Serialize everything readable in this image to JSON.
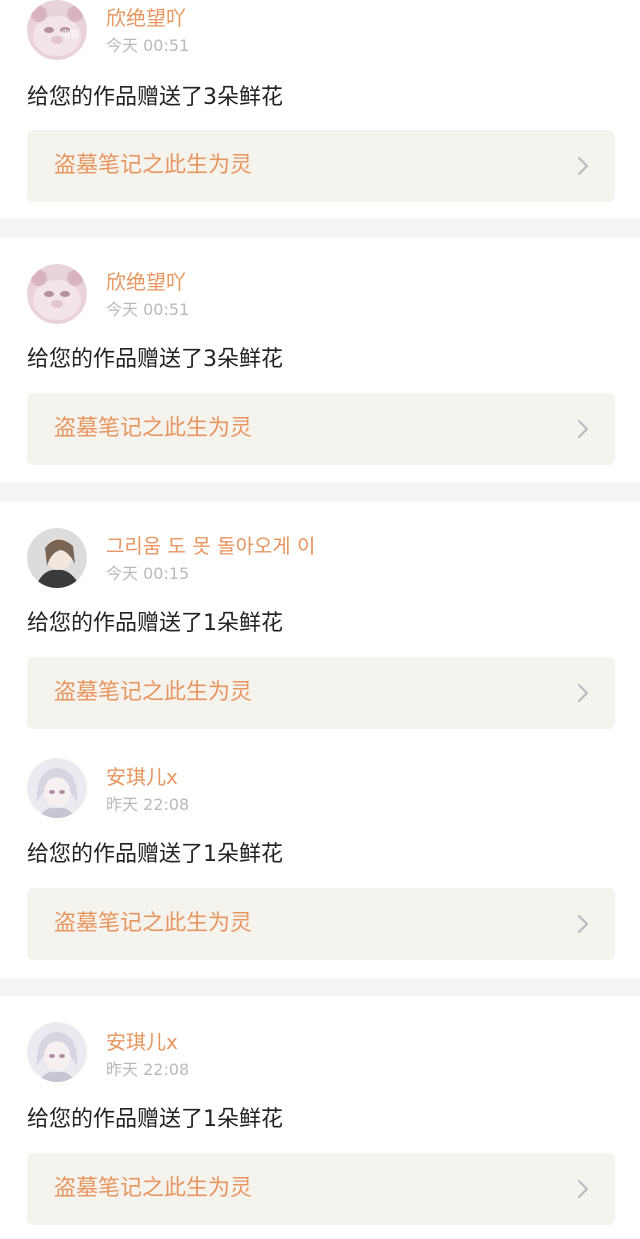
{
  "colors": {
    "accent": "#e8955e",
    "timestamp": "#b9b9b9",
    "message": "#222222",
    "link_background": "#f5f3ee",
    "divider": "#f5f5f5"
  },
  "notifications": [
    {
      "user_name": "欣绝望吖",
      "time": "今天 00:51",
      "message": "给您的作品赠送了3朵鲜花",
      "work_title": "盗墓笔记之此生为灵",
      "avatar_badge": "电智",
      "chevron_icon": "chevron-right-icon"
    },
    {
      "user_name": "欣绝望吖",
      "time": "今天 00:51",
      "message": "给您的作品赠送了3朵鲜花",
      "work_title": "盗墓笔记之此生为灵",
      "chevron_icon": "chevron-right-icon"
    },
    {
      "user_name": "그리움 도 못 돌아오게 이",
      "time": "今天 00:15",
      "message": "给您的作品赠送了1朵鲜花",
      "work_title": "盗墓笔记之此生为灵",
      "chevron_icon": "chevron-right-icon"
    },
    {
      "user_name": "安琪儿x",
      "time": "昨天 22:08",
      "message": "给您的作品赠送了1朵鲜花",
      "work_title": "盗墓笔记之此生为灵",
      "chevron_icon": "chevron-right-icon"
    },
    {
      "user_name": "安琪儿x",
      "time": "昨天 22:08",
      "message": "给您的作品赠送了1朵鲜花",
      "work_title": "盗墓笔记之此生为灵",
      "chevron_icon": "chevron-right-icon"
    }
  ]
}
